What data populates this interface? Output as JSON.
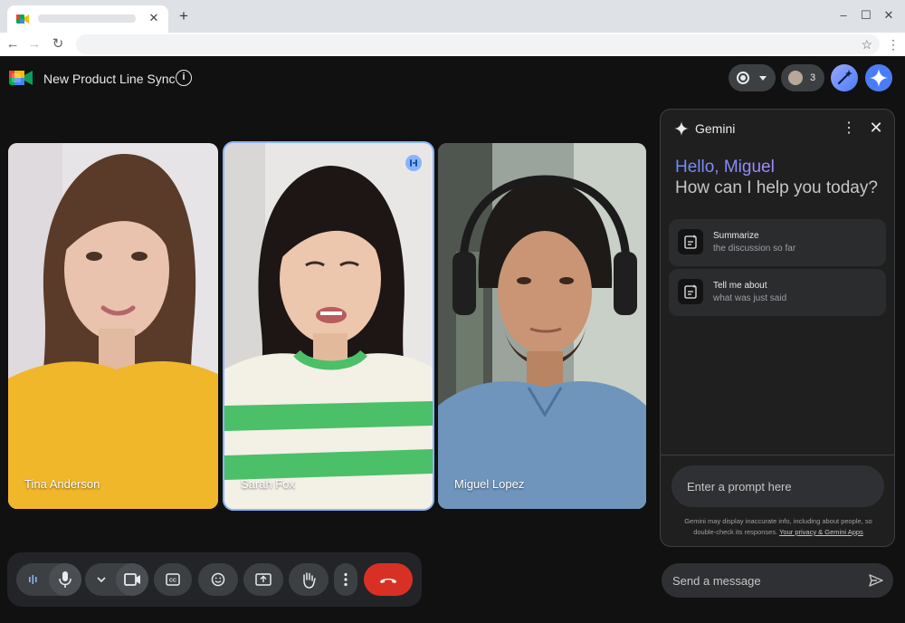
{
  "browser": {
    "tab_close": "✕",
    "new_tab": "+",
    "window_controls": {
      "minimize": "–",
      "maximize": "☐",
      "close": "✕"
    },
    "nav": {
      "back": "←",
      "forward": "→",
      "reload": "↻"
    },
    "star": "☆",
    "menu": "⋮"
  },
  "meeting": {
    "title": "New Product Line Sync",
    "info": "i",
    "participants_count": "3"
  },
  "participants": [
    {
      "name": "Tina Anderson",
      "active": false
    },
    {
      "name": "Sarah Fox",
      "active": true
    },
    {
      "name": "Miguel Lopez",
      "active": false
    }
  ],
  "gemini": {
    "title": "Gemini",
    "more": "⋮",
    "close": "✕",
    "greeting": "Hello, Miguel",
    "subtitle": "How can I help you today?",
    "suggestions": [
      {
        "title": "Summarize",
        "subtitle": "the discussion so far"
      },
      {
        "title": "Tell me about",
        "subtitle": "what was just said"
      }
    ],
    "prompt_placeholder": "Enter a prompt here",
    "disclaimer": "Gemini may display inaccurate info, including about people, so double-check its responses.",
    "disclaimer_link": "Your privacy & Gemini Apps"
  },
  "chat": {
    "placeholder": "Send a message"
  },
  "colors": {
    "background": "#111111",
    "accent": "#8ab4f8",
    "end_call": "#d93025",
    "gemini_blue": "#4a7df5"
  },
  "icons": [
    "meet-logo-icon",
    "info-icon",
    "record-icon",
    "people-icon",
    "wand-icon",
    "gemini-sparkle-icon",
    "mic-icon",
    "camera-icon",
    "captions-icon",
    "emoji-icon",
    "present-icon",
    "hand-raise-icon",
    "more-vert-icon",
    "end-call-icon",
    "send-icon"
  ]
}
